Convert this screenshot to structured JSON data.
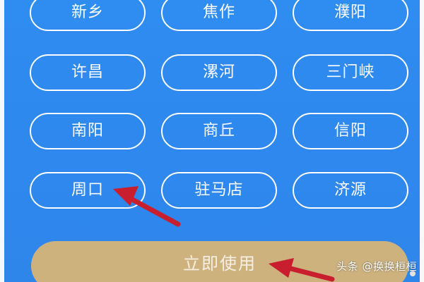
{
  "cities": [
    {
      "label": "新乡"
    },
    {
      "label": "焦作"
    },
    {
      "label": "濮阳"
    },
    {
      "label": "许昌"
    },
    {
      "label": "漯河"
    },
    {
      "label": "三门峡"
    },
    {
      "label": "南阳"
    },
    {
      "label": "商丘"
    },
    {
      "label": "信阳"
    },
    {
      "label": "周口"
    },
    {
      "label": "驻马店"
    },
    {
      "label": "济源"
    }
  ],
  "action": {
    "use_now_label": "立即使用"
  },
  "watermark": {
    "text": "头条 @换换桓桓"
  },
  "colors": {
    "background": "#2f8cf0",
    "button_outline": "#ffffff",
    "primary_button": "#cdb27e",
    "annotation_arrow": "#c81e2d"
  }
}
